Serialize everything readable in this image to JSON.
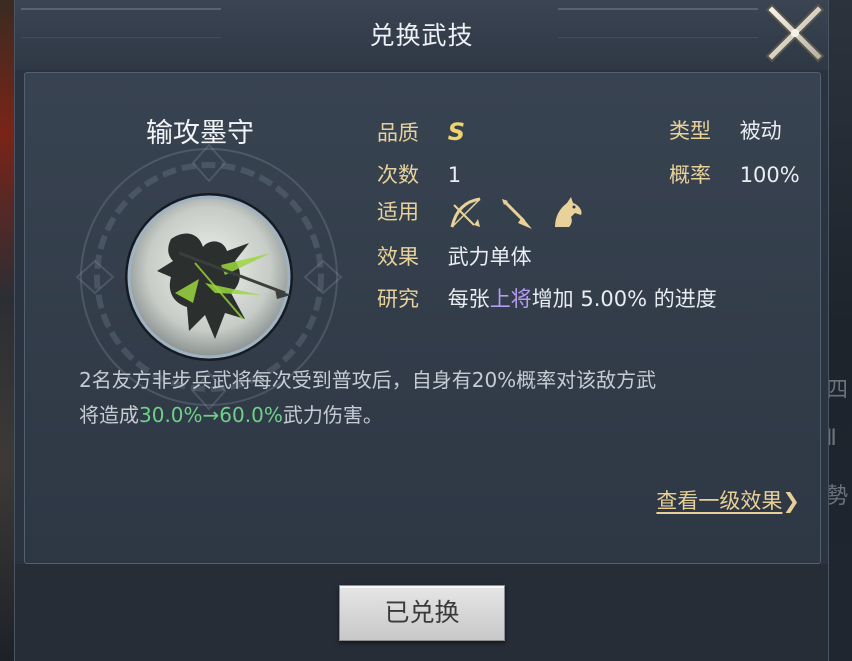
{
  "dialog": {
    "title": "兑换武技",
    "close_label": "关闭"
  },
  "skill": {
    "name": "输攻墨守",
    "quality_label": "品质",
    "quality_value": "S",
    "type_label": "类型",
    "type_value": "被动",
    "count_label": "次数",
    "count_value": "1",
    "rate_label": "概率",
    "rate_value": "100%",
    "applicable_label": "适用",
    "applicable_icons": [
      "bow-icon",
      "spear-icon",
      "horse-icon"
    ],
    "effect_label": "效果",
    "effect_value": "武力单体",
    "research_label": "研究",
    "research_prefix": "每张",
    "research_highlight": "上将",
    "research_suffix": "增加 5.00% 的进度"
  },
  "description": {
    "line1": "2名友方非步兵武将每次受到普攻后，自身有20%概率对该敌方武",
    "line2_prefix": "将造成",
    "line2_highlight": "30.0%→60.0%",
    "line2_suffix": "武力伤害。"
  },
  "link": {
    "label": "查看一级效果",
    "chevron": "❯"
  },
  "footer": {
    "button_label": "已兑换"
  },
  "colors": {
    "label_gold": "#e8d29a",
    "quality_gold": "#f0d46e",
    "highlight_purple": "#b59cf0",
    "highlight_green": "#6fd08a"
  },
  "background": {
    "right_glyphs": [
      "四",
      "Ⅱ",
      "勢"
    ]
  }
}
